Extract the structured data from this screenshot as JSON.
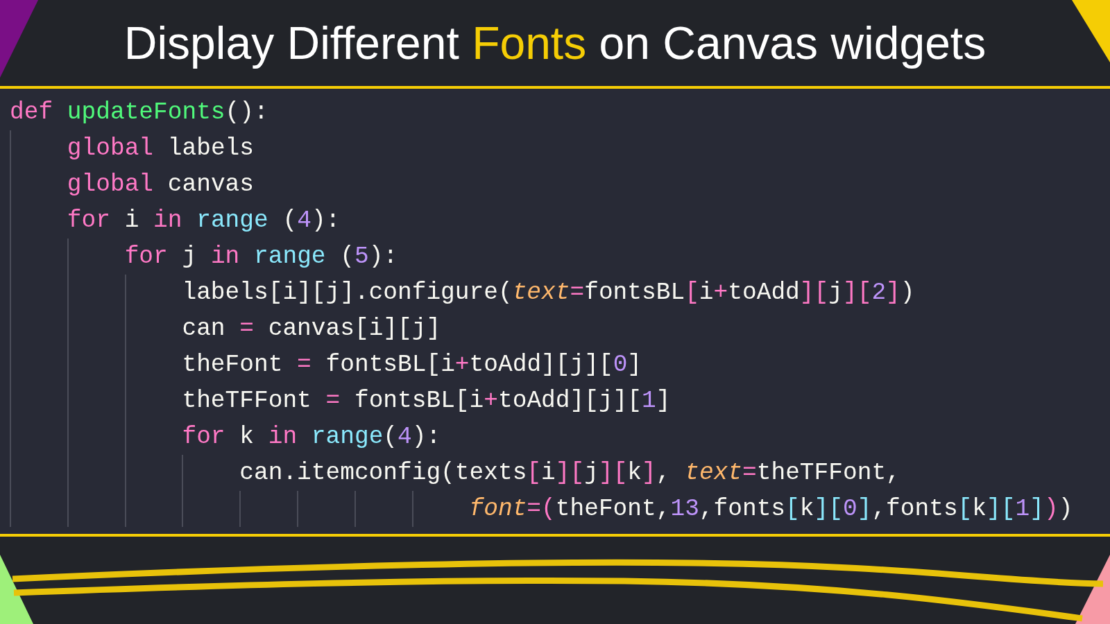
{
  "title": {
    "parts": [
      {
        "text": "Display Different ",
        "highlight": false
      },
      {
        "text": "Fonts",
        "highlight": true
      },
      {
        "text": " on Canvas widgets",
        "highlight": false
      }
    ]
  },
  "code": {
    "lines": [
      [
        {
          "kind": "keyword",
          "text": "def "
        },
        {
          "kind": "function",
          "text": "updateFonts"
        },
        {
          "kind": "plain",
          "text": "():"
        }
      ],
      [
        {
          "kind": "keyword",
          "text": "    global"
        },
        {
          "kind": "plain",
          "text": " labels"
        }
      ],
      [
        {
          "kind": "keyword",
          "text": "    global"
        },
        {
          "kind": "plain",
          "text": " canvas"
        }
      ],
      [
        {
          "kind": "keyword",
          "text": "    for"
        },
        {
          "kind": "plain",
          "text": " i "
        },
        {
          "kind": "keyword",
          "text": "in "
        },
        {
          "kind": "builtin",
          "text": "range"
        },
        {
          "kind": "plain",
          "text": " ("
        },
        {
          "kind": "number",
          "text": "4"
        },
        {
          "kind": "plain",
          "text": "):"
        }
      ],
      [
        {
          "kind": "keyword",
          "text": "        for"
        },
        {
          "kind": "plain",
          "text": " j "
        },
        {
          "kind": "keyword",
          "text": "in "
        },
        {
          "kind": "builtin",
          "text": "range"
        },
        {
          "kind": "plain",
          "text": " ("
        },
        {
          "kind": "number",
          "text": "5"
        },
        {
          "kind": "plain",
          "text": "):"
        }
      ],
      [
        {
          "kind": "plain",
          "text": "            labels[i][j].configure("
        },
        {
          "kind": "param",
          "text": "text"
        },
        {
          "kind": "operator",
          "text": "="
        },
        {
          "kind": "plain",
          "text": "fontsBL"
        },
        {
          "kind": "bracket1",
          "text": "["
        },
        {
          "kind": "plain",
          "text": "i"
        },
        {
          "kind": "operator",
          "text": "+"
        },
        {
          "kind": "plain",
          "text": "toAdd"
        },
        {
          "kind": "bracket1",
          "text": "]["
        },
        {
          "kind": "plain",
          "text": "j"
        },
        {
          "kind": "bracket1",
          "text": "]["
        },
        {
          "kind": "number",
          "text": "2"
        },
        {
          "kind": "bracket1",
          "text": "]"
        },
        {
          "kind": "plain",
          "text": ")"
        }
      ],
      [
        {
          "kind": "plain",
          "text": "            can "
        },
        {
          "kind": "operator",
          "text": "="
        },
        {
          "kind": "plain",
          "text": " canvas[i][j]"
        }
      ],
      [
        {
          "kind": "plain",
          "text": "            theFont "
        },
        {
          "kind": "operator",
          "text": "="
        },
        {
          "kind": "plain",
          "text": " fontsBL[i"
        },
        {
          "kind": "operator",
          "text": "+"
        },
        {
          "kind": "plain",
          "text": "toAdd][j]["
        },
        {
          "kind": "number",
          "text": "0"
        },
        {
          "kind": "plain",
          "text": "]"
        }
      ],
      [
        {
          "kind": "plain",
          "text": "            theTFFont "
        },
        {
          "kind": "operator",
          "text": "="
        },
        {
          "kind": "plain",
          "text": " fontsBL[i"
        },
        {
          "kind": "operator",
          "text": "+"
        },
        {
          "kind": "plain",
          "text": "toAdd][j]["
        },
        {
          "kind": "number",
          "text": "1"
        },
        {
          "kind": "plain",
          "text": "]"
        }
      ],
      [
        {
          "kind": "keyword",
          "text": "            for"
        },
        {
          "kind": "plain",
          "text": " k "
        },
        {
          "kind": "keyword",
          "text": "in "
        },
        {
          "kind": "builtin",
          "text": "range"
        },
        {
          "kind": "plain",
          "text": "("
        },
        {
          "kind": "number",
          "text": "4"
        },
        {
          "kind": "plain",
          "text": "):"
        }
      ],
      [
        {
          "kind": "plain",
          "text": "                can.itemconfig(texts"
        },
        {
          "kind": "bracket1",
          "text": "["
        },
        {
          "kind": "plain",
          "text": "i"
        },
        {
          "kind": "bracket1",
          "text": "]["
        },
        {
          "kind": "plain",
          "text": "j"
        },
        {
          "kind": "bracket1",
          "text": "]["
        },
        {
          "kind": "plain",
          "text": "k"
        },
        {
          "kind": "bracket1",
          "text": "]"
        },
        {
          "kind": "plain",
          "text": ", "
        },
        {
          "kind": "param",
          "text": "text"
        },
        {
          "kind": "operator",
          "text": "="
        },
        {
          "kind": "plain",
          "text": "theTFFont,"
        }
      ],
      [
        {
          "kind": "param",
          "text": "                                font"
        },
        {
          "kind": "operator",
          "text": "="
        },
        {
          "kind": "bracket1",
          "text": "("
        },
        {
          "kind": "plain",
          "text": "theFont,"
        },
        {
          "kind": "number",
          "text": "13"
        },
        {
          "kind": "plain",
          "text": ",fonts"
        },
        {
          "kind": "bracket2",
          "text": "["
        },
        {
          "kind": "plain",
          "text": "k"
        },
        {
          "kind": "bracket2",
          "text": "]["
        },
        {
          "kind": "number",
          "text": "0"
        },
        {
          "kind": "bracket2",
          "text": "]"
        },
        {
          "kind": "plain",
          "text": ",fonts"
        },
        {
          "kind": "bracket2",
          "text": "["
        },
        {
          "kind": "plain",
          "text": "k"
        },
        {
          "kind": "bracket2",
          "text": "]["
        },
        {
          "kind": "number",
          "text": "1"
        },
        {
          "kind": "bracket2",
          "text": "]"
        },
        {
          "kind": "bracket1",
          "text": ")"
        },
        {
          "kind": "plain",
          "text": ")"
        }
      ]
    ]
  }
}
